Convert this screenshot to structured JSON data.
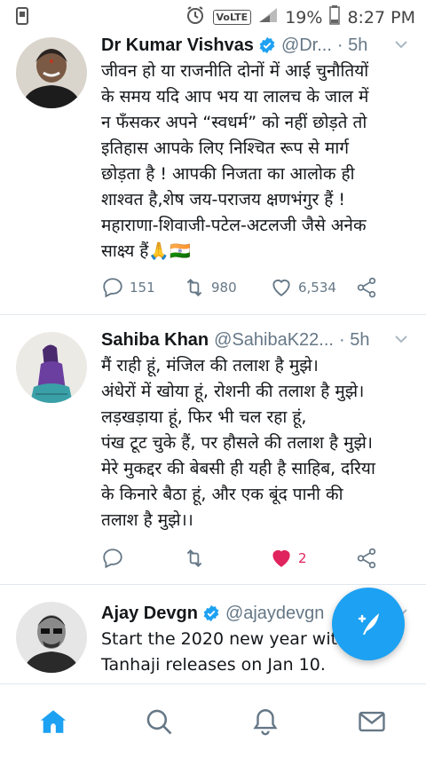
{
  "status_bar": {
    "volte": "VoLTE",
    "battery_percent": "19%",
    "time": "8:27 PM"
  },
  "tweets": [
    {
      "name": "Dr Kumar Vishvas",
      "handle": "@Dr...",
      "time": "· 5h",
      "verified": true,
      "text": "जीवन हो या राजनीति दोनों में आई चुनौतियों\nके समय यदि आप भय या लालच के जाल में\nन फँसकर अपने “स्वधर्म” को नहीं छोड़ते तो\nइतिहास आपके लिए निश्चित रूप से मार्ग\nछोड़ता है ! आपकी निजता का आलोक ही\nशाश्वत है,शेष जय-पराजय क्षणभंगुर हैं !\nमहाराणा-शिवाजी-पटेल-अटलजी जैसे अनेक\nसाक्ष्य हैं🙏🇮🇳",
      "replies": "151",
      "retweets": "980",
      "likes": "6,534",
      "liked": false
    },
    {
      "name": "Sahiba Khan",
      "handle": "@SahibaK22...",
      "time": "· 5h",
      "verified": false,
      "text": "मैं राही हूं, मंजिल की तलाश है मुझे।\nअंधेरों में खोया हूं, रोशनी की तलाश है मुझे।\nलड़खड़ाया हूं, फिर भी चल रहा हूं,\nपंख टूट चुके हैं, पर हौसले की तलाश है मुझे।\nमेरे मुकद्दर की बेबसी ही यही है साहिब, दरिया\nके किनारे बैठा हूं, और एक बूंद पानी की\nतलाश है मुझे।।",
      "replies": "",
      "retweets": "",
      "likes": "2",
      "liked": true
    },
    {
      "name": "Ajay Devgn",
      "handle": "@ajaydevgn",
      "time": "",
      "verified": true,
      "text": "Start the 2020 new year with\nTanhaji releases on Jan 10."
    }
  ],
  "colors": {
    "accent": "#1da1f2",
    "like_red": "#e0245e",
    "muted": "#657786"
  },
  "icons": {
    "fab": "compose-tweet-icon",
    "nav": [
      "home-icon",
      "search-icon",
      "bell-icon",
      "mail-icon"
    ]
  }
}
